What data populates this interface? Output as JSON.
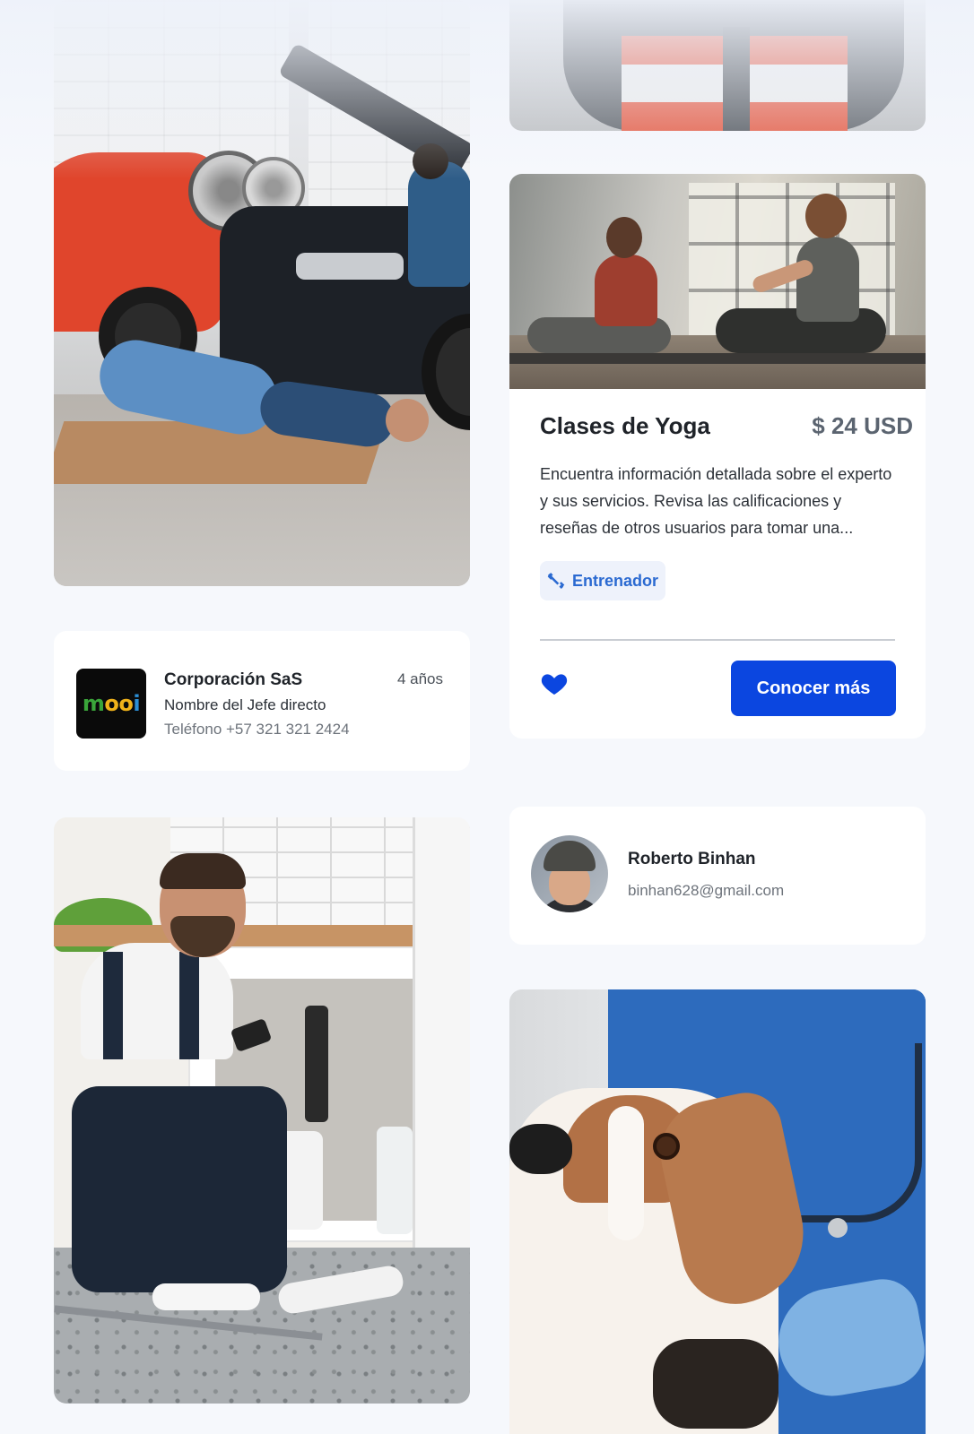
{
  "cards": {
    "yoga": {
      "title": "Clases de Yoga",
      "price": "$ 24 USD",
      "description": "Encuentra información detallada sobre el experto y sus servicios. Revisa las calificaciones y reseñas de otros usuarios para tomar una...",
      "tag": "Entrenador",
      "tag_icon": "dumbbell-icon",
      "favorite_icon": "heart-icon",
      "favorite_color": "#0b46e0",
      "cta_label": "Conocer más"
    },
    "company": {
      "logo_text_1": "m",
      "logo_text_2": "oo",
      "logo_text_3": "i",
      "name": "Corporación SaS",
      "boss": "Nombre del Jefe directo",
      "phone": "Teléfono +57 321 321 2424",
      "years": "4 años"
    },
    "profile": {
      "name": "Roberto Binhan",
      "email": "binhan628@gmail.com"
    }
  },
  "colors": {
    "accent": "#0b46e0",
    "tag_text": "#2b6ad1",
    "tag_bg": "#eef2fb",
    "background": "#f6f8fc"
  }
}
